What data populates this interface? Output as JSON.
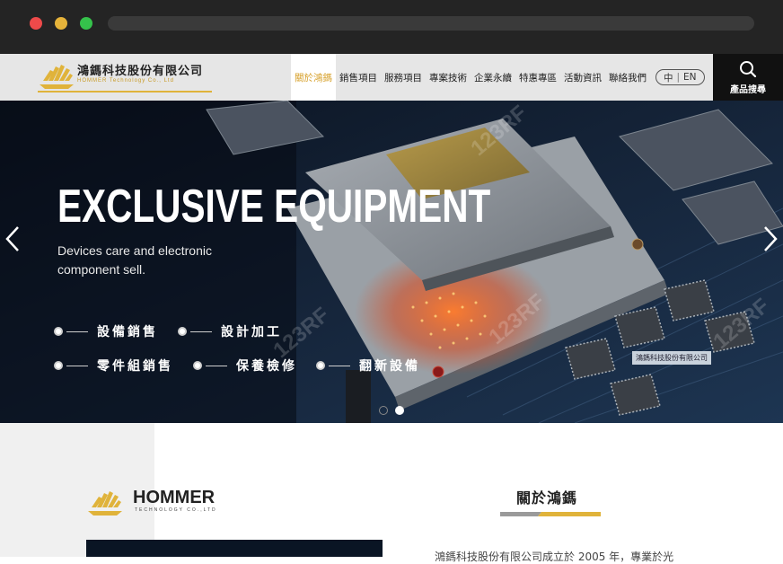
{
  "browser": {
    "buttons": [
      "close",
      "minimize",
      "maximize"
    ]
  },
  "header": {
    "logo_title": "鴻鎷科技股份有限公司",
    "logo_subtitle": "HOMMER Technology Co., Ltd",
    "nav": [
      {
        "label": "關於鴻鎷",
        "active": true
      },
      {
        "label": "銷售項目",
        "active": false
      },
      {
        "label": "服務項目",
        "active": false
      },
      {
        "label": "專案技術",
        "active": false
      },
      {
        "label": "企業永續",
        "active": false
      },
      {
        "label": "特惠專區",
        "active": false
      },
      {
        "label": "活動資訊",
        "active": false
      },
      {
        "label": "聯絡我們",
        "active": false
      }
    ],
    "lang_zh": "中",
    "lang_en": "EN",
    "search_label": "產品搜尋",
    "accent_color": "#d7a12c"
  },
  "hero": {
    "title": "EXCLUSIVE EQUIPMENT",
    "subtitle": "Devices care and electronic component sell.",
    "services": [
      "設備銷售",
      "設計加工",
      "零件組銷售",
      "保養檢修",
      "翻新設備"
    ],
    "tag": "鴻鎷科技股份有限公司",
    "watermark": "123RF",
    "slides_total": 2,
    "slide_active": 2
  },
  "about": {
    "brand_name": "HOMMER",
    "brand_sub": "TECHNOLOGY CO.,LTD",
    "title": "關於鴻鎷",
    "intro": "鴻鎷科技股份有限公司成立於 2005 年，專業於光"
  }
}
